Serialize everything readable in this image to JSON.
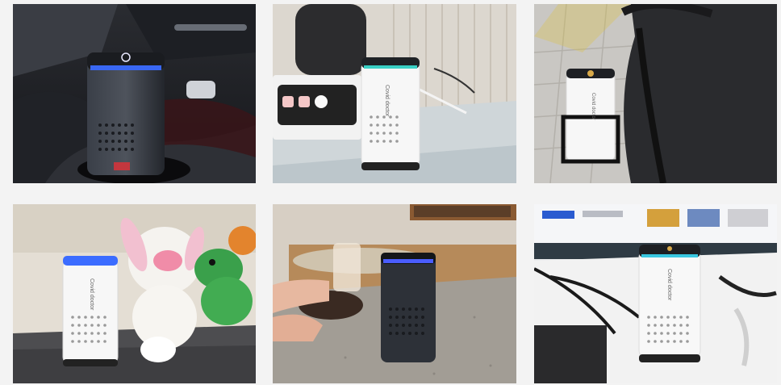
{
  "photos": [
    {
      "id": "car-cupholder",
      "device_color": "black",
      "device_label": ""
    },
    {
      "id": "shelf-speaker",
      "device_color": "white",
      "device_label": "Covid doctor"
    },
    {
      "id": "stroller",
      "device_color": "white",
      "device_label": "Covid doctor"
    },
    {
      "id": "plush-toys",
      "device_color": "white",
      "device_label": "Covid doctor"
    },
    {
      "id": "cafe-table",
      "device_color": "black",
      "device_label": ""
    },
    {
      "id": "office-desk",
      "device_color": "white",
      "device_label": "Covid doctor"
    }
  ],
  "colors": {
    "accent_ring": "#3b6cff",
    "device_white": "#f7f7f7",
    "device_black": "#2b2f36",
    "background": "#f3f3f3"
  }
}
